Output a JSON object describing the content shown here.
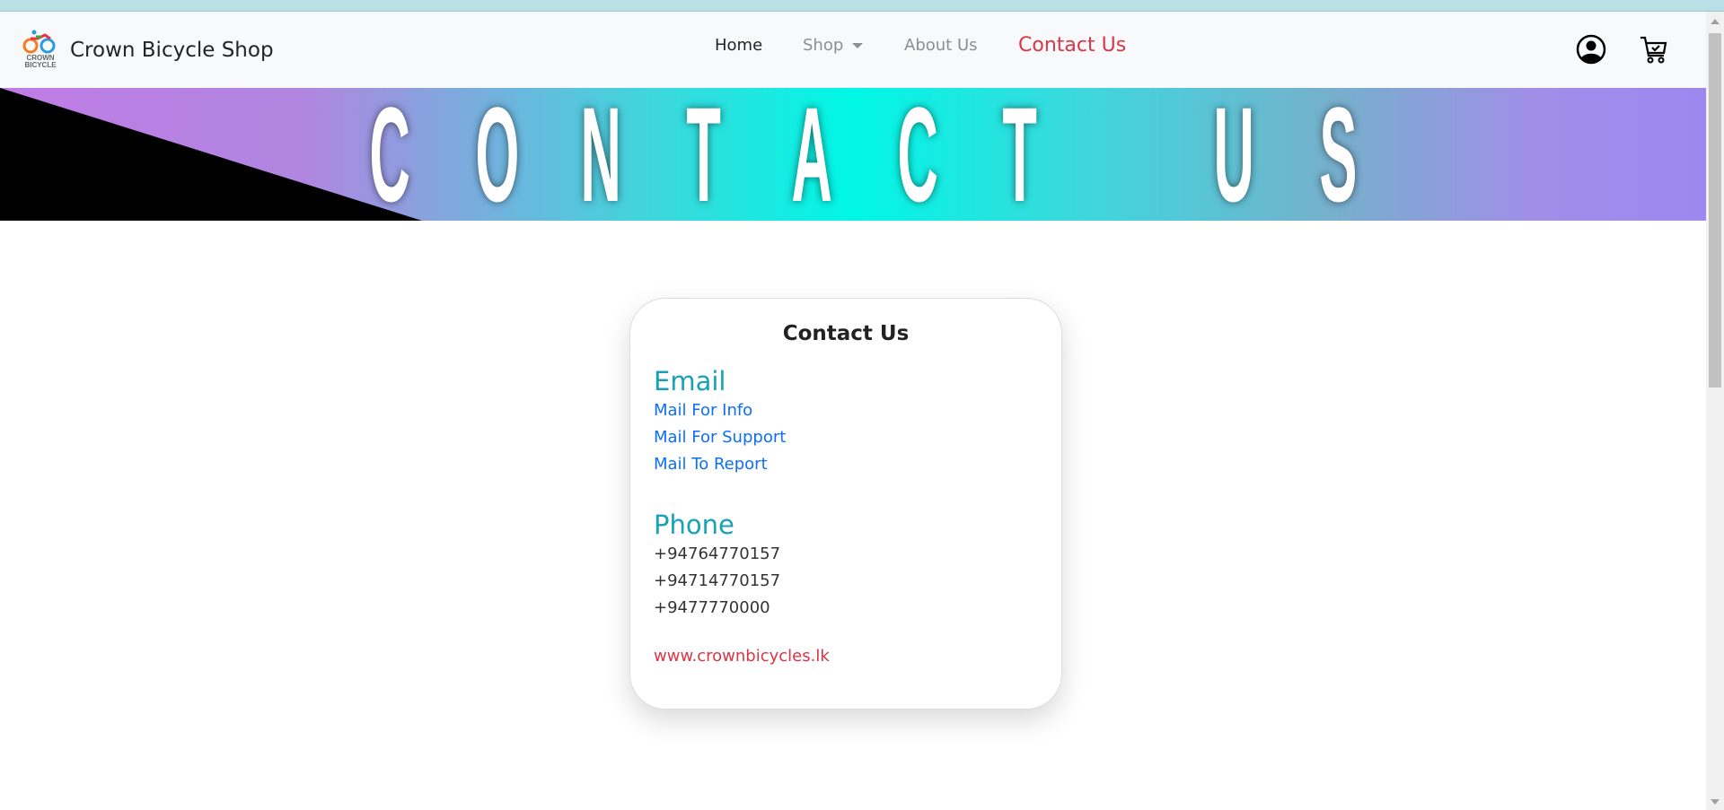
{
  "navbar": {
    "brand": "Crown Bicycle Shop",
    "logo_text": "CROWN BICYCLE SHOP",
    "links": [
      {
        "label": "Home"
      },
      {
        "label": "Shop"
      },
      {
        "label": "About Us"
      },
      {
        "label": "Contact Us"
      }
    ],
    "icons": [
      "user-circle-icon",
      "cart-check-icon"
    ]
  },
  "banner": {
    "title": [
      "C",
      "O",
      "N",
      "T",
      "A",
      "C",
      "T",
      " ",
      "U",
      "S"
    ]
  },
  "card": {
    "title": "Contact Us",
    "email_heading": "Email",
    "email_links": [
      "Mail For Info",
      "Mail For Support",
      "Mail To Report"
    ],
    "phone_heading": "Phone",
    "phones": [
      "+94764770157",
      "+94714770157",
      "+9477770000"
    ],
    "website": "www.crownbicycles.lk"
  },
  "colors": {
    "accent": "#17a2b8",
    "link": "#0d6efd",
    "danger": "#dc3545"
  }
}
